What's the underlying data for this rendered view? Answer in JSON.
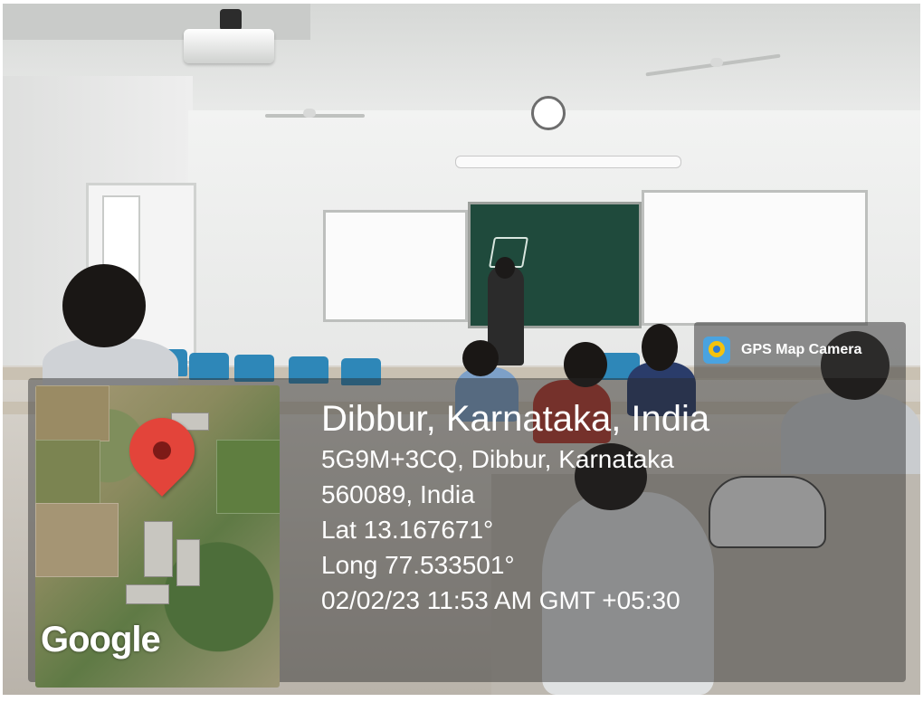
{
  "overlay": {
    "app_name": "GPS Map Camera",
    "app_icon": "gps-map-camera-icon",
    "location_title": "Dibbur, Karnataka, India",
    "address_line1": "5G9M+3CQ, Dibbur, Karnataka",
    "address_line2": "560089, India",
    "latitude": "Lat 13.167671°",
    "longitude": "Long 77.533501°",
    "datetime": "02/02/23 11:53 AM GMT +05:30",
    "map_attribution": "Google",
    "pin_icon": "map-pin-icon",
    "pin_color": "#e3443a"
  }
}
